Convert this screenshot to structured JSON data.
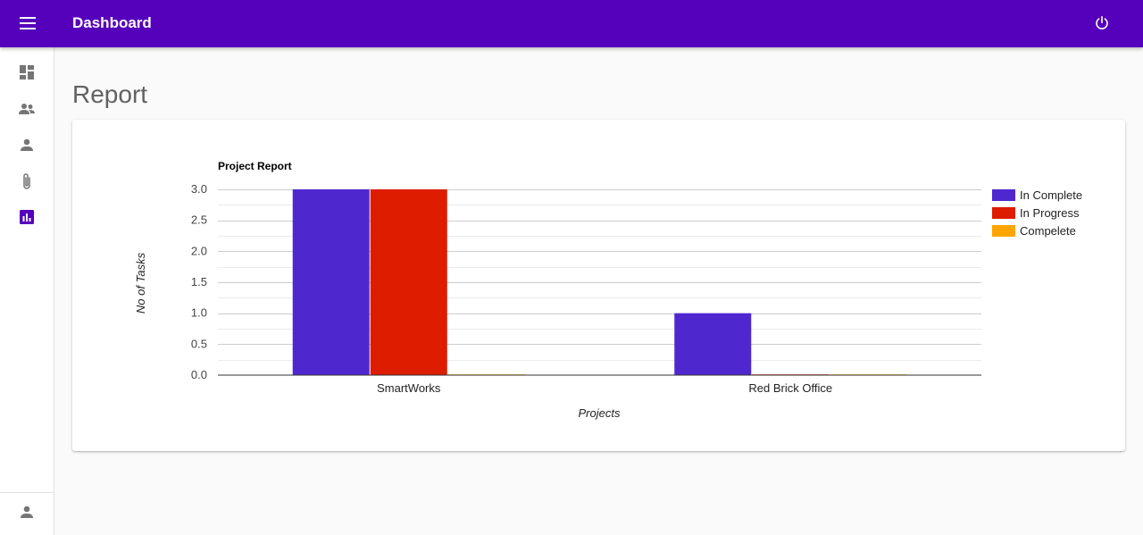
{
  "app": {
    "title": "Dashboard"
  },
  "header": {
    "menu_icon": "menu-icon",
    "power_icon": "power-icon"
  },
  "sidebar": {
    "items": [
      {
        "name": "dashboard",
        "icon": "dashboard-icon",
        "active": false
      },
      {
        "name": "teams",
        "icon": "people-icon",
        "active": false
      },
      {
        "name": "users",
        "icon": "person-icon",
        "active": false
      },
      {
        "name": "attachments",
        "icon": "paperclip-icon",
        "active": false
      },
      {
        "name": "reports",
        "icon": "bar-chart-icon",
        "active": true
      }
    ],
    "footer_icon": "person-icon"
  },
  "page": {
    "title": "Report"
  },
  "colors": {
    "primary": "#5500bb",
    "in_complete": "#4f27cf",
    "in_progress": "#dd1c00",
    "compelete": "#ffa500"
  },
  "chart_data": {
    "type": "bar",
    "title": "Project Report",
    "xlabel": "Projects",
    "ylabel": "No of Tasks",
    "categories": [
      "SmartWorks",
      "Red Brick Office"
    ],
    "series": [
      {
        "name": "In Complete",
        "color": "#4f27cf",
        "values": [
          3,
          1
        ]
      },
      {
        "name": "In Progress",
        "color": "#dd1c00",
        "values": [
          3,
          0
        ]
      },
      {
        "name": "Compelete",
        "color": "#ffa500",
        "values": [
          0,
          0
        ]
      }
    ],
    "ylim": [
      0,
      3
    ],
    "yticks": [
      "0.0",
      "0.5",
      "1.0",
      "1.5",
      "2.0",
      "2.5",
      "3.0"
    ],
    "grid": true,
    "legend_position": "right"
  }
}
